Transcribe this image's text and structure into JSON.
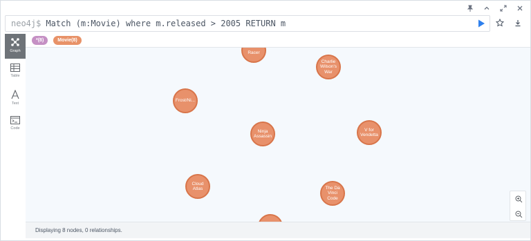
{
  "editor": {
    "prompt": "neo4j$",
    "query": "Match (m:Movie) where m.released > 2005 RETURN m"
  },
  "window_controls": [
    {
      "name": "pin-icon"
    },
    {
      "name": "chevron-up-icon"
    },
    {
      "name": "expand-icon"
    },
    {
      "name": "close-icon"
    }
  ],
  "tags": {
    "all": "*(8)",
    "movie": "Movie(8)"
  },
  "sidebar": {
    "items": [
      {
        "label": "Graph",
        "icon": "graph-icon",
        "active": true
      },
      {
        "label": "Table",
        "icon": "table-icon",
        "active": false
      },
      {
        "label": "Text",
        "icon": "text-icon",
        "active": false
      },
      {
        "label": "Code",
        "icon": "code-icon",
        "active": false
      }
    ]
  },
  "nodes": [
    {
      "label": "Racer"
    },
    {
      "label": "Charlie Wilson's War"
    },
    {
      "label": "Frost/Ni..."
    },
    {
      "label": "Ninja Assassin"
    },
    {
      "label": "V for Vendetta"
    },
    {
      "label": "Cloud Atlas"
    },
    {
      "label": "The Da Vinci Code"
    },
    {
      "label": ""
    }
  ],
  "status": {
    "text": "Displaying 8 nodes, 0 relationships."
  },
  "colors": {
    "node_fill": "#e8916b",
    "node_border": "#d8754a",
    "tag_all": "#c590c4",
    "tag_movie": "#e89268",
    "run_button": "#2f80ed",
    "sidebar_active": "#6e7378"
  }
}
